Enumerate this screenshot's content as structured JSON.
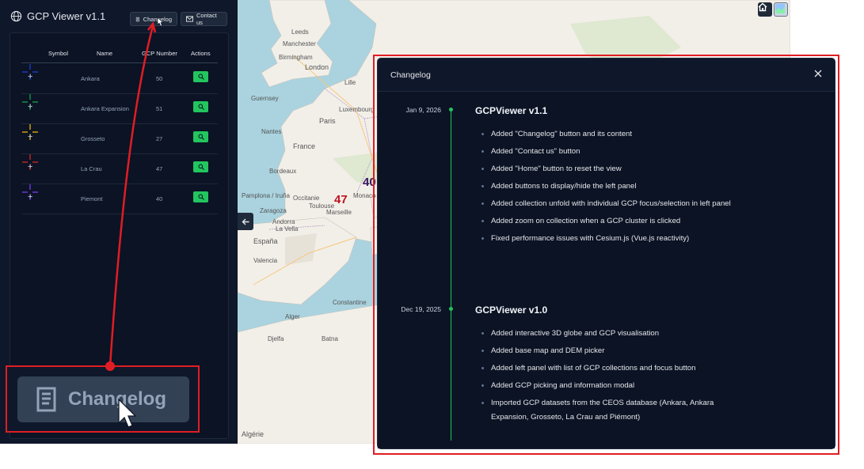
{
  "app": {
    "title": "GCP Viewer v1.1",
    "changelog_label": "Changelog",
    "contact_label": "Contact us"
  },
  "table": {
    "headers": [
      "Symbol",
      "Name",
      "GCP Number",
      "Actions"
    ],
    "rows": [
      {
        "name": "Ankara",
        "gcp": "50",
        "color": "#1d3fd8"
      },
      {
        "name": "Ankara Expansion",
        "gcp": "51",
        "color": "#16a34a"
      },
      {
        "name": "Grosseto",
        "gcp": "27",
        "color": "#eab308"
      },
      {
        "name": "La Crau",
        "gcp": "47",
        "color": "#dc2626"
      },
      {
        "name": "Piemont",
        "gcp": "40",
        "color": "#7c3aed"
      }
    ]
  },
  "map": {
    "labels": [
      "Leeds",
      "Manchester",
      "Birmingham",
      "London",
      "Guernsey",
      "Paris",
      "Lille",
      "Luxembourg",
      "Nantes",
      "France",
      "Bordeaux",
      "Pamplona / Iruña",
      "Occitanie",
      "Toulouse",
      "Andorra",
      "Marseille",
      "Monaco",
      "España",
      "La Vella",
      "Zaragoza",
      "Valencia",
      "Constantine",
      "Alger",
      "Djelfa",
      "Batna",
      "Algérie"
    ],
    "gcp_markers": [
      "47",
      "40"
    ],
    "home_icon": "home-icon",
    "layer_icon": "layer-picker-icon",
    "collapse_icon": "arrow-left-icon"
  },
  "changelog": {
    "title": "Changelog",
    "close_icon": "close-icon",
    "releases": [
      {
        "date": "Jan 9, 2026",
        "version": "GCPViewer v1.1",
        "entries": [
          "Added \"Changelog\" button and its content",
          "Added \"Contact us\" button",
          "Added \"Home\" button to reset the view",
          "Added buttons to display/hide the left panel",
          "Added collection unfold with individual GCP focus/selection in left panel",
          "Added zoom on collection when a GCP cluster is clicked",
          "Fixed performance issues with Cesium.js (Vue.js reactivity)"
        ]
      },
      {
        "date": "Dec 19, 2025",
        "version": "GCPViewer v1.0",
        "entries": [
          "Added interactive 3D globe and GCP visualisation",
          "Added base map and DEM picker",
          "Added left panel with list of GCP collections and focus button",
          "Added GCP picking and information modal",
          "Imported GCP datasets from the CEOS database (Ankara, Ankara Expansion, Grosseto, La Crau and Piémont)"
        ]
      }
    ]
  },
  "annotation": {
    "zoom_label": "Changelog",
    "highlight_color": "#e11d24"
  }
}
